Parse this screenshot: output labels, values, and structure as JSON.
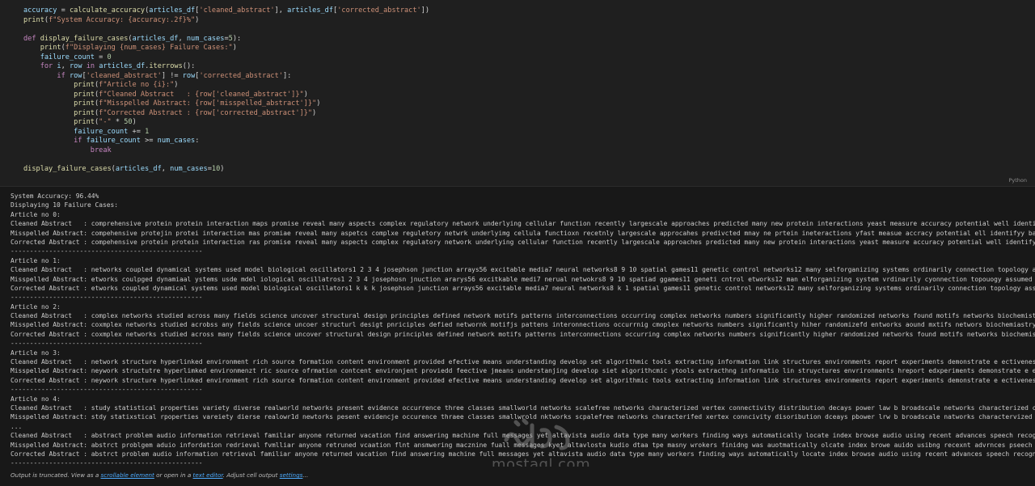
{
  "code_cell": {
    "language_badge": "Python",
    "lines": [
      "accuracy = calculate_accuracy(articles_df['cleaned_abstract'], articles_df['corrected_abstract'])",
      "print(f\"System Accuracy: {accuracy:.2f}%\")",
      "",
      "def display_failure_cases(articles_df, num_cases=5):",
      "    print(f\"Displaying {num_cases} Failure Cases:\")",
      "    failure_count = 0",
      "    for i, row in articles_df.iterrows():",
      "        if row['cleaned_abstract'] != row['corrected_abstract']:",
      "            print(f\"Article no {i}:\")",
      "            print(f\"Cleaned Abstract   : {row['cleaned_abstract']}\")",
      "            print(f\"Misspelled Abstract: {row['misspelled_abstract']}\")",
      "            print(f\"Corrected Abstract : {row['corrected_abstract']}\")",
      "            print(\"-\" * 50)",
      "            failure_count += 1",
      "            if failure_count >= num_cases:",
      "                break",
      "",
      "display_failure_cases(articles_df, num_cases=10)"
    ]
  },
  "output": {
    "lines": [
      "System Accuracy: 96.44%",
      "Displaying 10 Failure Cases:",
      "Article no 0:",
      "Cleaned Abstract   : comprehensive protein protein interaction maps promise reveal many aspects complex regulatory network underlying cellular function recently largescale approaches predicted many new protein interactions yeast measure accuracy potential well identify bi",
      "Misspelled Abstract: compehensive protejin protei interaction mas promiae reveal many aspetcs complxe reguletory netwrk underlyimg cellula functioxn recetnly largescale approcahes predivcted mnay ne prtein ineteractions yfast measue accracy potential ell identifyy bases t",
      "Corrected Abstract : compehensive protein protein interaction ras promise reveal many aspects complex regulatory network underlying cellular function recently largescale approaches predicted many new protein interactions yeast measure accuracy potential well identify bias",
      "--------------------------------------------------",
      "Article no 1:",
      "Cleaned Abstract   : networks coupled dynamical systems used model biological oscillators1 2 3 4 josephson junction arrays56 excitable media7 neural networks8 9 10 spatial games11 genetic control networks12 many selforganizing systems ordinarily connection topology assume",
      "Misspelled Abstract: etworks coulpged dynamiaal ystems usde mdel iological oscillatros1 2 3 4 josephosn jnuction ararys56 excitkable medi7 nerual netwokrs8 9 10 spatiad ggames11 geneti cntrol etworks12 man elforganizing system vrdinarily cyonnection topouogy assumed eihte",
      "Corrected Abstract : etworks coupled dynamical systems used model biological oscillators1 k k k josephson junction arrays56 excitable media7 neural networks8 k 1 spatial games11 genetic control networks12 many selforganizing systems ordinarily connection topology assumed ",
      "--------------------------------------------------",
      "Article no 2:",
      "Cleaned Abstract   : complex networks studied across many fields science uncover structural design principles defined network motifs patterns interconnections occurring complex networks numbers significantly higher randomized networks found motifs networks biochemistry ne",
      "Misspelled Abstract: coxmplex networks studied acrobss any fields science uncoer structurl desigt pnriciples defied networnk motifjs pattens interonnections occurrnig cmoplex networks numbers significantly hiher randomizefd entworks aound mxtifs networs biochemiastry neur",
      "Corrected Abstract : coxmplex networks studied across many fields science uncover structural design principles defined network motifs patterns interconnections occurring complex networks numbers significantly higher randomized networks found motifs networks biochemistry ne",
      "--------------------------------------------------",
      "Article no 3:",
      "Cleaned Abstract   : network structure hyperlinked environment rich source formation content environment provided efective means understanding develop set algorithmic tools extracting information link structures environments report experiments demonstrate e ectiveness var",
      "Misspelled Abstract: neywork structutre hyperlimked environmenzt ric source ofrmation contcent environjent proviedd feective jmeans understanjing develop siet algorithcmic ytools extracthng informatio lin struyctures envrironments hreport edxperiments demonstrate e ectivenee",
      "Corrected Abstract : neywork structure hyperlinked environment rich source formation content environment provided efective means understanding develop set algorithmic tools extracting information link structures environments report experiments demonstrate e ectiveness var",
      "--------------------------------------------------",
      "Article no 4:",
      "Cleaned Abstract   : study statistical properties variety diverse realworld networks present evidence occurrence three classes smallworld networks scalefree networks characterized vertex connectivity distribution decays power law b broadscale networks characterized connec",
      "Misspelled Abstract: stdy statixstical rpoperties vareiety dierse realowr1d newtorks pesent evidencje occurence thraee classes smallwrold nktworks scpalefree nelworks characterifed xertex conncivity disoribution dceays pbower lrw b broadscale natworks charactervized conn",
      "...",
      "Cleaned Abstract   : abstract problem audio information retrieval familiar anyone returned vacation find answering machine full messages yet altavista audio data type many workers finding ways automatically locate index browse audio using recent advances speech recognitio",
      "Misspelled Abstract: abstrct problgem aduio infordation redrieval fvmlliar anyone retruned vcaation flnt ansmwering macznine fuall messages kyet altavlosta kudio dtaa tpe masny wrokers finidng was auotmatically olcate index browe auido usibng recexnt advrnces pseech reognit",
      "Corrected Abstract : abstrct problem audio information retrieval familiar anyone returned vacation find answering machine full messages yet altavista audio data type many workers finding ways automatically locate index browse audio using recent advances speech recognition",
      "--------------------------------------------------"
    ]
  },
  "truncation": {
    "prefix": "Output is truncated. View as a ",
    "scrollable_link": "scrollable element",
    "middle": " or open in a ",
    "editor_link": "text editor",
    "middle2": ". Adjust cell output ",
    "settings_link": "settings",
    "suffix": "..."
  },
  "watermark": {
    "text": "mostaql.com",
    "logo_icon": "mostaql-logo-icon"
  },
  "colors": {
    "keyword": "#c586c0",
    "function": "#dcdcaa",
    "variable": "#9cdcfe",
    "string": "#ce9178",
    "number": "#b5cea8",
    "link": "#4daafc"
  }
}
